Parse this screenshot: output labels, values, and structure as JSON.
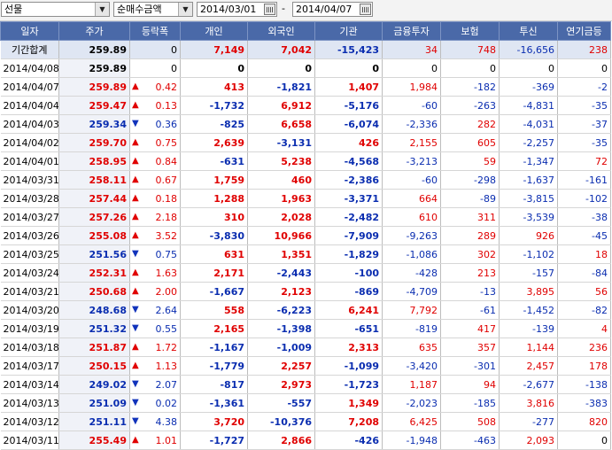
{
  "toolbar": {
    "market": "선물",
    "metric": "순매수금액",
    "date_from": "2014/03/01",
    "date_sep": "-",
    "date_to": "2014/04/07"
  },
  "columns": [
    "일자",
    "주가",
    "등락폭",
    "개인",
    "외국인",
    "기관",
    "금융투자",
    "보험",
    "투신",
    "연기금등"
  ],
  "colors": {
    "header_bg": "#4a69a8",
    "up": "#e00000",
    "down": "#0a2db0",
    "total_bg": "#dfe6f3"
  },
  "rows": [
    {
      "date": "기간합계",
      "price": "259.89",
      "pc": "flat",
      "dir": "",
      "chg": "0",
      "indiv": "7,149",
      "foreign": "7,042",
      "inst": "-15,423",
      "fin": "34",
      "ins": "748",
      "trust": "-16,656",
      "pension": "238",
      "total": true
    },
    {
      "date": "2014/04/08",
      "price": "259.89",
      "pc": "flat",
      "dir": "",
      "chg": "0",
      "indiv": "0",
      "foreign": "0",
      "inst": "0",
      "fin": "0",
      "ins": "0",
      "trust": "0",
      "pension": "0"
    },
    {
      "date": "2014/04/07",
      "price": "259.89",
      "pc": "up",
      "dir": "up",
      "chg": "0.42",
      "indiv": "413",
      "foreign": "-1,821",
      "inst": "1,407",
      "fin": "1,984",
      "ins": "-182",
      "trust": "-369",
      "pension": "-2"
    },
    {
      "date": "2014/04/04",
      "price": "259.47",
      "pc": "up",
      "dir": "up",
      "chg": "0.13",
      "indiv": "-1,732",
      "foreign": "6,912",
      "inst": "-5,176",
      "fin": "-60",
      "ins": "-263",
      "trust": "-4,831",
      "pension": "-35"
    },
    {
      "date": "2014/04/03",
      "price": "259.34",
      "pc": "down",
      "dir": "down",
      "chg": "0.36",
      "indiv": "-825",
      "foreign": "6,658",
      "inst": "-6,074",
      "fin": "-2,336",
      "ins": "282",
      "trust": "-4,031",
      "pension": "-37"
    },
    {
      "date": "2014/04/02",
      "price": "259.70",
      "pc": "up",
      "dir": "up",
      "chg": "0.75",
      "indiv": "2,639",
      "foreign": "-3,131",
      "inst": "426",
      "fin": "2,155",
      "ins": "605",
      "trust": "-2,257",
      "pension": "-35"
    },
    {
      "date": "2014/04/01",
      "price": "258.95",
      "pc": "up",
      "dir": "up",
      "chg": "0.84",
      "indiv": "-631",
      "foreign": "5,238",
      "inst": "-4,568",
      "fin": "-3,213",
      "ins": "59",
      "trust": "-1,347",
      "pension": "72"
    },
    {
      "date": "2014/03/31",
      "price": "258.11",
      "pc": "up",
      "dir": "up",
      "chg": "0.67",
      "indiv": "1,759",
      "foreign": "460",
      "inst": "-2,386",
      "fin": "-60",
      "ins": "-298",
      "trust": "-1,637",
      "pension": "-161"
    },
    {
      "date": "2014/03/28",
      "price": "257.44",
      "pc": "up",
      "dir": "up",
      "chg": "0.18",
      "indiv": "1,288",
      "foreign": "1,963",
      "inst": "-3,371",
      "fin": "664",
      "ins": "-89",
      "trust": "-3,815",
      "pension": "-102"
    },
    {
      "date": "2014/03/27",
      "price": "257.26",
      "pc": "up",
      "dir": "up",
      "chg": "2.18",
      "indiv": "310",
      "foreign": "2,028",
      "inst": "-2,482",
      "fin": "610",
      "ins": "311",
      "trust": "-3,539",
      "pension": "-38"
    },
    {
      "date": "2014/03/26",
      "price": "255.08",
      "pc": "up",
      "dir": "up",
      "chg": "3.52",
      "indiv": "-3,830",
      "foreign": "10,966",
      "inst": "-7,909",
      "fin": "-9,263",
      "ins": "289",
      "trust": "926",
      "pension": "-45"
    },
    {
      "date": "2014/03/25",
      "price": "251.56",
      "pc": "down",
      "dir": "down",
      "chg": "0.75",
      "indiv": "631",
      "foreign": "1,351",
      "inst": "-1,829",
      "fin": "-1,086",
      "ins": "302",
      "trust": "-1,102",
      "pension": "18"
    },
    {
      "date": "2014/03/24",
      "price": "252.31",
      "pc": "up",
      "dir": "up",
      "chg": "1.63",
      "indiv": "2,171",
      "foreign": "-2,443",
      "inst": "-100",
      "fin": "-428",
      "ins": "213",
      "trust": "-157",
      "pension": "-84"
    },
    {
      "date": "2014/03/21",
      "price": "250.68",
      "pc": "up",
      "dir": "up",
      "chg": "2.00",
      "indiv": "-1,667",
      "foreign": "2,123",
      "inst": "-869",
      "fin": "-4,709",
      "ins": "-13",
      "trust": "3,895",
      "pension": "56"
    },
    {
      "date": "2014/03/20",
      "price": "248.68",
      "pc": "down",
      "dir": "down",
      "chg": "2.64",
      "indiv": "558",
      "foreign": "-6,223",
      "inst": "6,241",
      "fin": "7,792",
      "ins": "-61",
      "trust": "-1,452",
      "pension": "-82"
    },
    {
      "date": "2014/03/19",
      "price": "251.32",
      "pc": "down",
      "dir": "down",
      "chg": "0.55",
      "indiv": "2,165",
      "foreign": "-1,398",
      "inst": "-651",
      "fin": "-819",
      "ins": "417",
      "trust": "-139",
      "pension": "4"
    },
    {
      "date": "2014/03/18",
      "price": "251.87",
      "pc": "up",
      "dir": "up",
      "chg": "1.72",
      "indiv": "-1,167",
      "foreign": "-1,009",
      "inst": "2,313",
      "fin": "635",
      "ins": "357",
      "trust": "1,144",
      "pension": "236"
    },
    {
      "date": "2014/03/17",
      "price": "250.15",
      "pc": "up",
      "dir": "up",
      "chg": "1.13",
      "indiv": "-1,779",
      "foreign": "2,257",
      "inst": "-1,099",
      "fin": "-3,420",
      "ins": "-301",
      "trust": "2,457",
      "pension": "178"
    },
    {
      "date": "2014/03/14",
      "price": "249.02",
      "pc": "down",
      "dir": "down",
      "chg": "2.07",
      "indiv": "-817",
      "foreign": "2,973",
      "inst": "-1,723",
      "fin": "1,187",
      "ins": "94",
      "trust": "-2,677",
      "pension": "-138"
    },
    {
      "date": "2014/03/13",
      "price": "251.09",
      "pc": "down",
      "dir": "down",
      "chg": "0.02",
      "indiv": "-1,361",
      "foreign": "-557",
      "inst": "1,349",
      "fin": "-2,023",
      "ins": "-185",
      "trust": "3,816",
      "pension": "-383"
    },
    {
      "date": "2014/03/12",
      "price": "251.11",
      "pc": "down",
      "dir": "down",
      "chg": "4.38",
      "indiv": "3,720",
      "foreign": "-10,376",
      "inst": "7,208",
      "fin": "6,425",
      "ins": "508",
      "trust": "-277",
      "pension": "820"
    },
    {
      "date": "2014/03/11",
      "price": "255.49",
      "pc": "up",
      "dir": "up",
      "chg": "1.01",
      "indiv": "-1,727",
      "foreign": "2,866",
      "inst": "-426",
      "fin": "-1,948",
      "ins": "-463",
      "trust": "2,093",
      "pension": "0"
    }
  ]
}
